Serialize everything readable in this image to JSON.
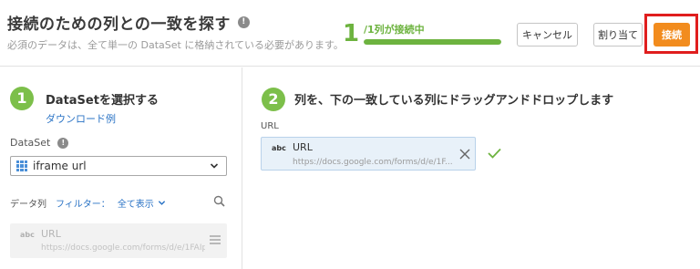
{
  "header": {
    "title": "接続のための列との一致を探す",
    "info_glyph": "!",
    "subtitle": "必須のデータは、全て単一の DataSet に格納されている必要があります。",
    "progress": {
      "number": "1",
      "text": "/1列が接続中",
      "fraction": 1.0
    },
    "buttons": {
      "cancel": "キャンセル",
      "assign": "割り当て",
      "connect": "接続"
    }
  },
  "step1": {
    "number": "1",
    "title": "DataSetを選択する",
    "download_link": "ダウンロード例",
    "dataset_label": "DataSet",
    "dataset_value": "iframe url",
    "filter": {
      "data_col_label": "データ列",
      "filter_label": "フィルター：",
      "filter_value": "全て表示"
    },
    "column": {
      "type": "abc",
      "name": "URL",
      "url": "https://docs.google.com/forms/d/e/1FAIp..."
    }
  },
  "step2": {
    "number": "2",
    "title": "列を、下の一致している列にドラッグアンドドロップします",
    "field_label": "URL",
    "matched": {
      "type": "abc",
      "name": "URL",
      "url": "https://docs.google.com/forms/d/e/1F..."
    }
  },
  "colors": {
    "accent_green": "#6db33f",
    "connect_orange": "#f28c1e",
    "highlight_red": "#e01e1e",
    "link_blue": "#2a73c5"
  },
  "icons": [
    "info-icon",
    "grid-icon",
    "chevron-down-icon",
    "search-icon",
    "drag-handle-icon",
    "close-icon",
    "check-icon"
  ]
}
